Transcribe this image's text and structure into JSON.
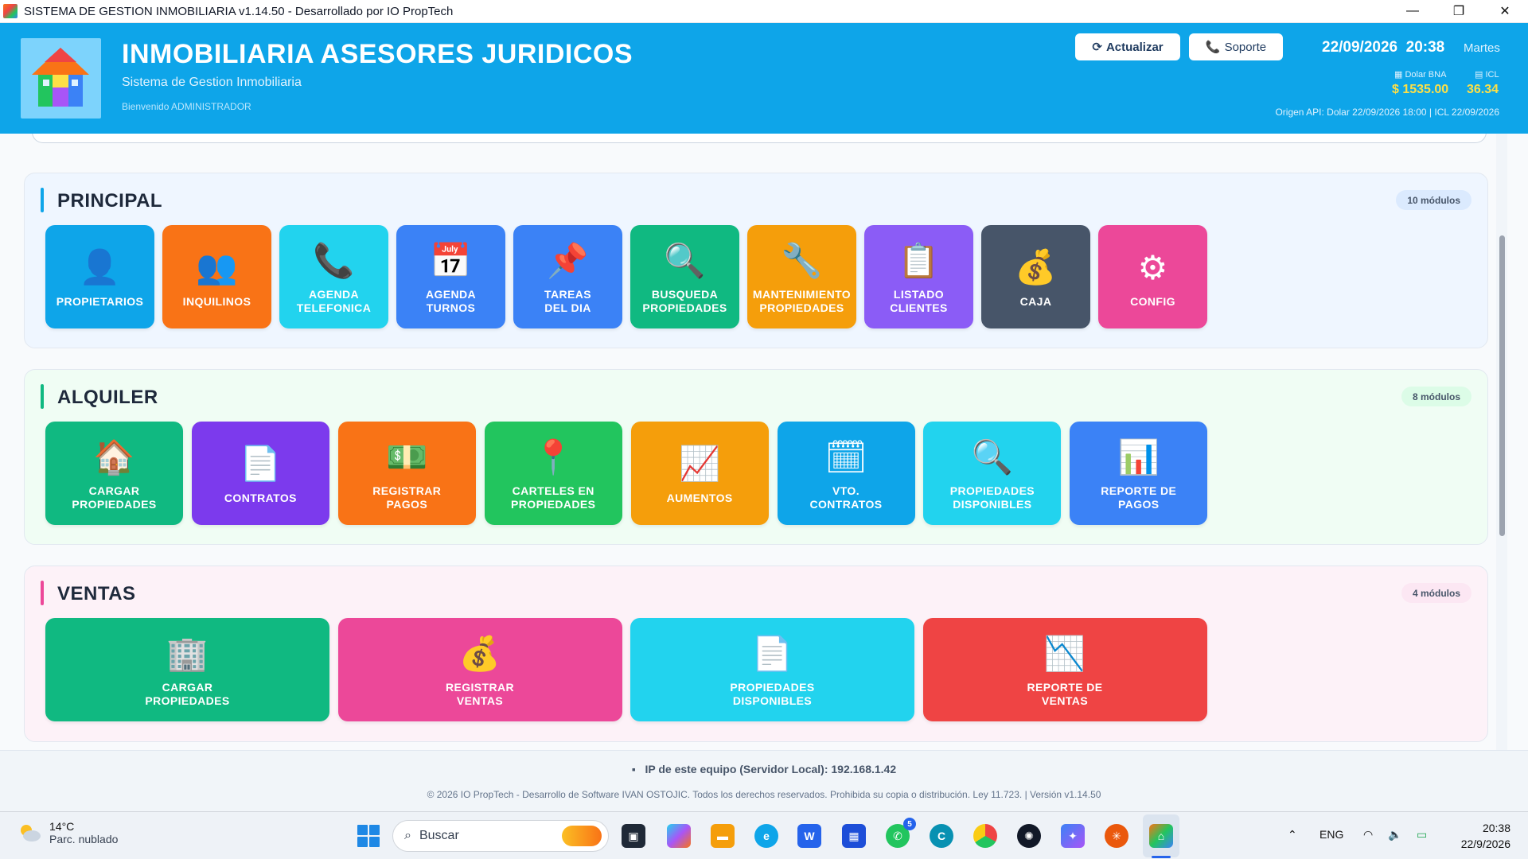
{
  "window": {
    "title": "SISTEMA DE GESTION INMOBILIARIA v1.14.50 - Desarrollado por IO PropTech",
    "minimize": "—",
    "restore": "❐",
    "close": "✕"
  },
  "header": {
    "title": "INMOBILIARIA ASESORES JURIDICOS",
    "subtitle": "Sistema de Gestion Inmobiliaria",
    "welcome": "Bienvenido ADMINISTRADOR",
    "refresh_label": "Actualizar",
    "support_label": "Soporte",
    "date": "22/09/2026",
    "time": "20:38",
    "weekday": "Martes",
    "dolar_label": "Dolar BNA",
    "dolar_value": "$ 1535.00",
    "icl_label": "ICL",
    "icl_value": "36.34",
    "api_origin": "Origen API: Dolar 22/09/2026 18:00 | ICL 22/09/2026"
  },
  "colors": {
    "header": "#0ea5e9",
    "principal_accent": "#0ea5e9",
    "alquiler_accent": "#10b981",
    "ventas_accent": "#ec4899"
  },
  "sections": {
    "principal": {
      "title": "PRINCIPAL",
      "badge": "10 módulos",
      "tiles": [
        {
          "label": "PROPIETARIOS",
          "icon": "person-icon",
          "color": "#0ea5e9"
        },
        {
          "label": "INQUILINOS",
          "icon": "people-icon",
          "color": "#f97316"
        },
        {
          "label": "AGENDA\nTELEFONICA",
          "icon": "phone-icon",
          "color": "#22d3ee"
        },
        {
          "label": "AGENDA\nTURNOS",
          "icon": "calendar-icon",
          "color": "#3b82f6"
        },
        {
          "label": "TAREAS\nDEL DIA",
          "icon": "pushpin-icon",
          "color": "#3b82f6"
        },
        {
          "label": "BUSQUEDA\nPROPIEDADES",
          "icon": "magnifier-icon",
          "color": "#10b981"
        },
        {
          "label": "MANTENIMIENTO\nPROPIEDADES",
          "icon": "wrench-icon",
          "color": "#f59e0b"
        },
        {
          "label": "LISTADO\nCLIENTES",
          "icon": "clipboard-icon",
          "color": "#8b5cf6"
        },
        {
          "label": "CAJA",
          "icon": "money-bag-icon",
          "color": "#475569"
        },
        {
          "label": "CONFIG",
          "icon": "gear-icon",
          "color": "#ec4899"
        }
      ]
    },
    "alquiler": {
      "title": "ALQUILER",
      "badge": "8 módulos",
      "tiles": [
        {
          "label": "CARGAR\nPROPIEDADES",
          "icon": "house-icon",
          "color": "#10b981"
        },
        {
          "label": "CONTRATOS",
          "icon": "document-icon",
          "color": "#7c3aed"
        },
        {
          "label": "REGISTRAR\nPAGOS",
          "icon": "banknote-icon",
          "color": "#f97316"
        },
        {
          "label": "CARTELES EN\nPROPIEDADES",
          "icon": "round-pin-icon",
          "color": "#22c55e"
        },
        {
          "label": "AUMENTOS",
          "icon": "chart-increasing-icon",
          "color": "#f59e0b"
        },
        {
          "label": "VTO.\nCONTRATOS",
          "icon": "spiral-calendar-icon",
          "color": "#0ea5e9"
        },
        {
          "label": "PROPIEDADES\nDISPONIBLES",
          "icon": "magnifier-icon",
          "color": "#22d3ee"
        },
        {
          "label": "REPORTE DE\nPAGOS",
          "icon": "bar-chart-icon",
          "color": "#3b82f6"
        }
      ]
    },
    "ventas": {
      "title": "VENTAS",
      "badge": "4 módulos",
      "tiles": [
        {
          "label": "CARGAR\nPROPIEDADES",
          "icon": "office-building-icon",
          "color": "#10b981"
        },
        {
          "label": "REGISTRAR\nVENTAS",
          "icon": "money-bag-icon",
          "color": "#ec4899"
        },
        {
          "label": "PROPIEDADES\nDISPONIBLES",
          "icon": "document-icon",
          "color": "#22d3ee"
        },
        {
          "label": "REPORTE DE\nVENTAS",
          "icon": "chart-decreasing-icon",
          "color": "#ef4444"
        }
      ]
    }
  },
  "footer": {
    "ip_text": "IP de este equipo (Servidor Local): 192.168.1.42",
    "copyright": "© 2026 IO PropTech - Desarrollo de Software IVAN OSTOJIC. Todos los derechos reservados. Prohibida su copia o distribución. Ley 11.723. | Versión v1.14.50"
  },
  "taskbar": {
    "temperature": "14°C",
    "condition": "Parc. nublado",
    "search_placeholder": "Buscar",
    "whatsapp_badge": "5",
    "language": "ENG",
    "clock_time": "20:38",
    "clock_date": "22/9/2026"
  }
}
